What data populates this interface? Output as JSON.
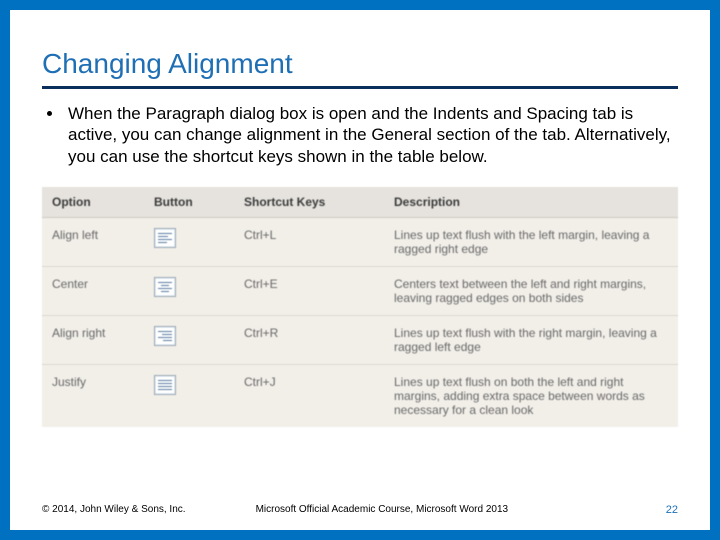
{
  "title": "Changing Alignment",
  "bullet": "When the Paragraph dialog box is open and the Indents and Spacing tab is active, you can change alignment in the General section of the tab. Alternatively, you can use the shortcut keys shown in the table below.",
  "table": {
    "headers": {
      "option": "Option",
      "button": "Button",
      "keys": "Shortcut Keys",
      "desc": "Description"
    },
    "rows": [
      {
        "option": "Align left",
        "icon": "left",
        "keys": "Ctrl+L",
        "desc": "Lines up text flush with the left margin, leaving a ragged right edge"
      },
      {
        "option": "Center",
        "icon": "center",
        "keys": "Ctrl+E",
        "desc": "Centers text between the left and right margins, leaving ragged edges on both sides"
      },
      {
        "option": "Align right",
        "icon": "right",
        "keys": "Ctrl+R",
        "desc": "Lines up text flush with the right margin, leaving a ragged left edge"
      },
      {
        "option": "Justify",
        "icon": "justify",
        "keys": "Ctrl+J",
        "desc": "Lines up text flush on both the left and right margins, adding extra space between words as necessary for a clean look"
      }
    ]
  },
  "footer": {
    "copyright": "© 2014, John Wiley & Sons, Inc.",
    "course": "Microsoft Official Academic Course, Microsoft Word 2013",
    "page": "22"
  }
}
